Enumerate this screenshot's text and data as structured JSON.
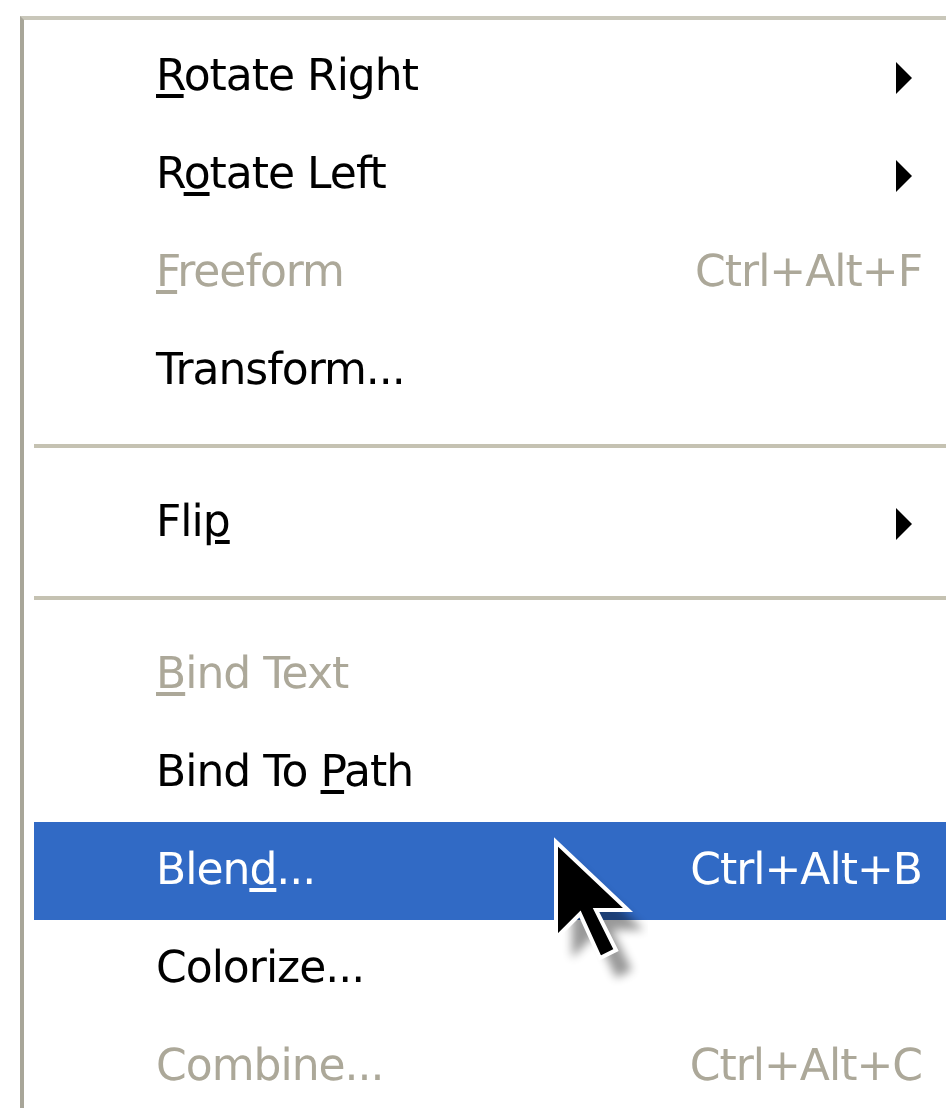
{
  "menu": {
    "items": [
      {
        "kind": "item",
        "label_parts": [
          {
            "text": "R",
            "underline": true
          },
          {
            "text": "otate Right",
            "underline": false
          }
        ],
        "submenu": true,
        "disabled": false,
        "selected": false
      },
      {
        "kind": "item",
        "label_parts": [
          {
            "text": "R",
            "underline": false
          },
          {
            "text": "o",
            "underline": true
          },
          {
            "text": "tate Left",
            "underline": false
          }
        ],
        "submenu": true,
        "disabled": false,
        "selected": false
      },
      {
        "kind": "item",
        "label_parts": [
          {
            "text": "F",
            "underline": true
          },
          {
            "text": "reeform",
            "underline": false
          }
        ],
        "shortcut": "Ctrl+Alt+F",
        "submenu": false,
        "disabled": true,
        "selected": false
      },
      {
        "kind": "item",
        "label_parts": [
          {
            "text": "Transform...",
            "underline": false
          }
        ],
        "submenu": false,
        "disabled": false,
        "selected": false
      },
      {
        "kind": "separator"
      },
      {
        "kind": "item",
        "label_parts": [
          {
            "text": "Fli",
            "underline": false
          },
          {
            "text": "p",
            "underline": true
          }
        ],
        "submenu": true,
        "disabled": false,
        "selected": false
      },
      {
        "kind": "separator"
      },
      {
        "kind": "item",
        "label_parts": [
          {
            "text": "B",
            "underline": true
          },
          {
            "text": "ind Text",
            "underline": false
          }
        ],
        "submenu": false,
        "disabled": true,
        "selected": false
      },
      {
        "kind": "item",
        "label_parts": [
          {
            "text": "Bind To ",
            "underline": false
          },
          {
            "text": "P",
            "underline": true
          },
          {
            "text": "ath",
            "underline": false
          }
        ],
        "submenu": false,
        "disabled": false,
        "selected": false
      },
      {
        "kind": "item",
        "label_parts": [
          {
            "text": "Blen",
            "underline": false
          },
          {
            "text": "d",
            "underline": true
          },
          {
            "text": "...",
            "underline": false
          }
        ],
        "shortcut": "Ctrl+Alt+B",
        "submenu": false,
        "disabled": false,
        "selected": true
      },
      {
        "kind": "item",
        "label_parts": [
          {
            "text": "Colorize...",
            "underline": false
          }
        ],
        "submenu": false,
        "disabled": false,
        "selected": false
      },
      {
        "kind": "item",
        "label_parts": [
          {
            "text": "Combine...",
            "underline": false
          }
        ],
        "shortcut": "Ctrl+Alt+C",
        "submenu": false,
        "disabled": true,
        "selected": false
      }
    ]
  }
}
